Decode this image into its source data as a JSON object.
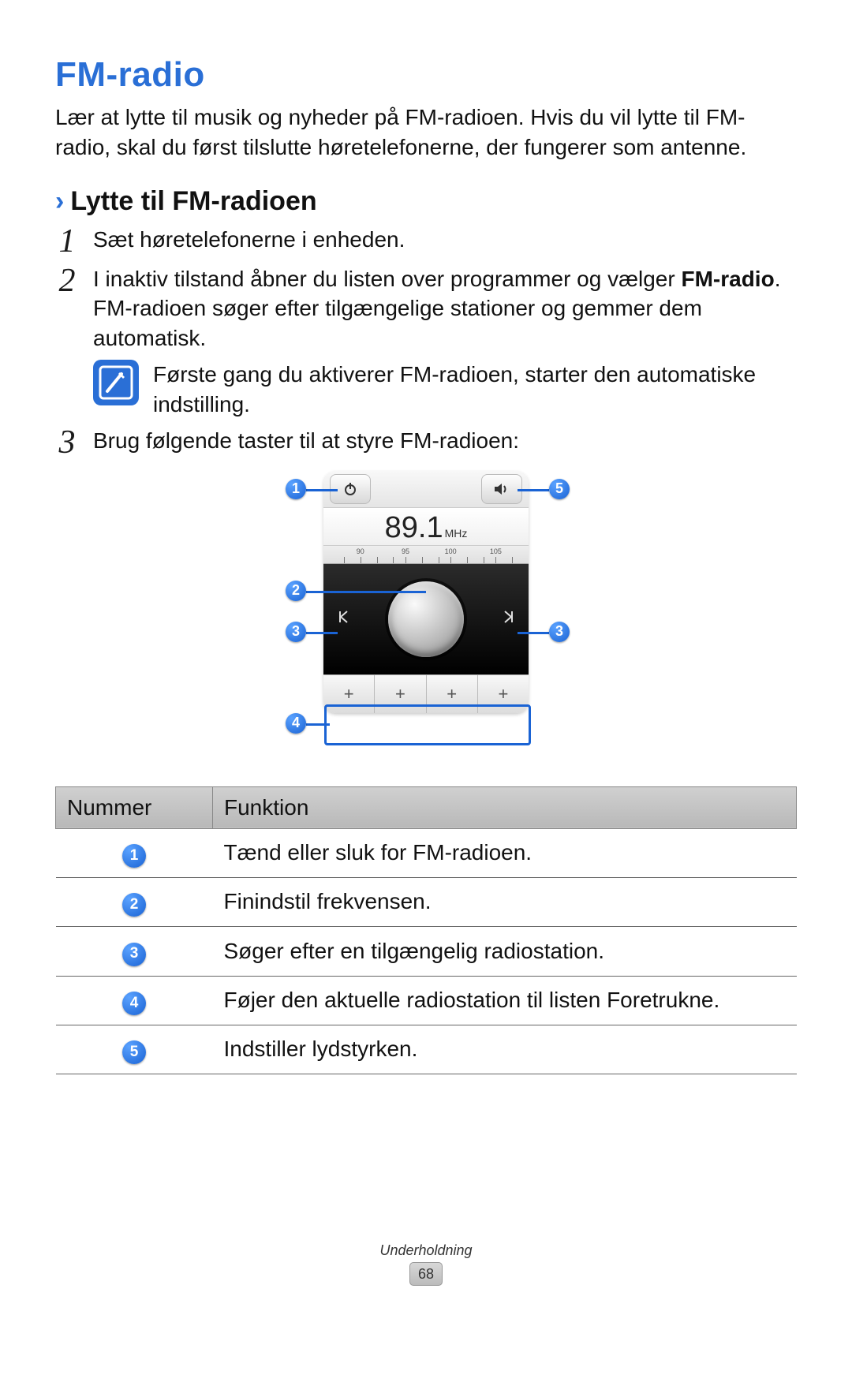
{
  "title": "FM-radio",
  "intro": "Lær at lytte til musik og nyheder på FM-radioen. Hvis du vil lytte til FM-radio, skal du først tilslutte høretelefonerne, der fungerer som antenne.",
  "subsection": {
    "chevron": "›",
    "text": "Lytte til FM-radioen"
  },
  "steps": {
    "s1": {
      "num": "1",
      "body": "Sæt høretelefonerne i enheden."
    },
    "s2": {
      "num": "2",
      "line1_pre": "I inaktiv tilstand åbner du listen over programmer og vælger ",
      "line1_bold": "FM-radio",
      "line1_post": ".",
      "line2": "FM-radioen søger efter tilgængelige stationer og gemmer dem automatisk."
    },
    "note": "Første gang du aktiverer FM-radioen, starter den automatiske indstilling.",
    "s3": {
      "num": "3",
      "body": "Brug følgende taster til at styre FM-radioen:"
    }
  },
  "radio": {
    "freq_value": "89.1",
    "freq_unit": "MHz",
    "ruler_labels": [
      "90",
      "95",
      "100",
      "105"
    ],
    "preset_plus": "+"
  },
  "callouts": {
    "c1": "1",
    "c2": "2",
    "c3": "3",
    "c4": "4",
    "c5": "5"
  },
  "table": {
    "head": {
      "num": "Nummer",
      "func": "Funktion"
    },
    "rows": {
      "r1": "Tænd eller sluk for FM-radioen.",
      "r2": "Finindstil frekvensen.",
      "r3": "Søger efter en tilgængelig radiostation.",
      "r4": "Føjer den aktuelle radiostation til listen Foretrukne.",
      "r5": "Indstiller lydstyrken."
    }
  },
  "footer": {
    "category": "Underholdning",
    "page": "68"
  }
}
